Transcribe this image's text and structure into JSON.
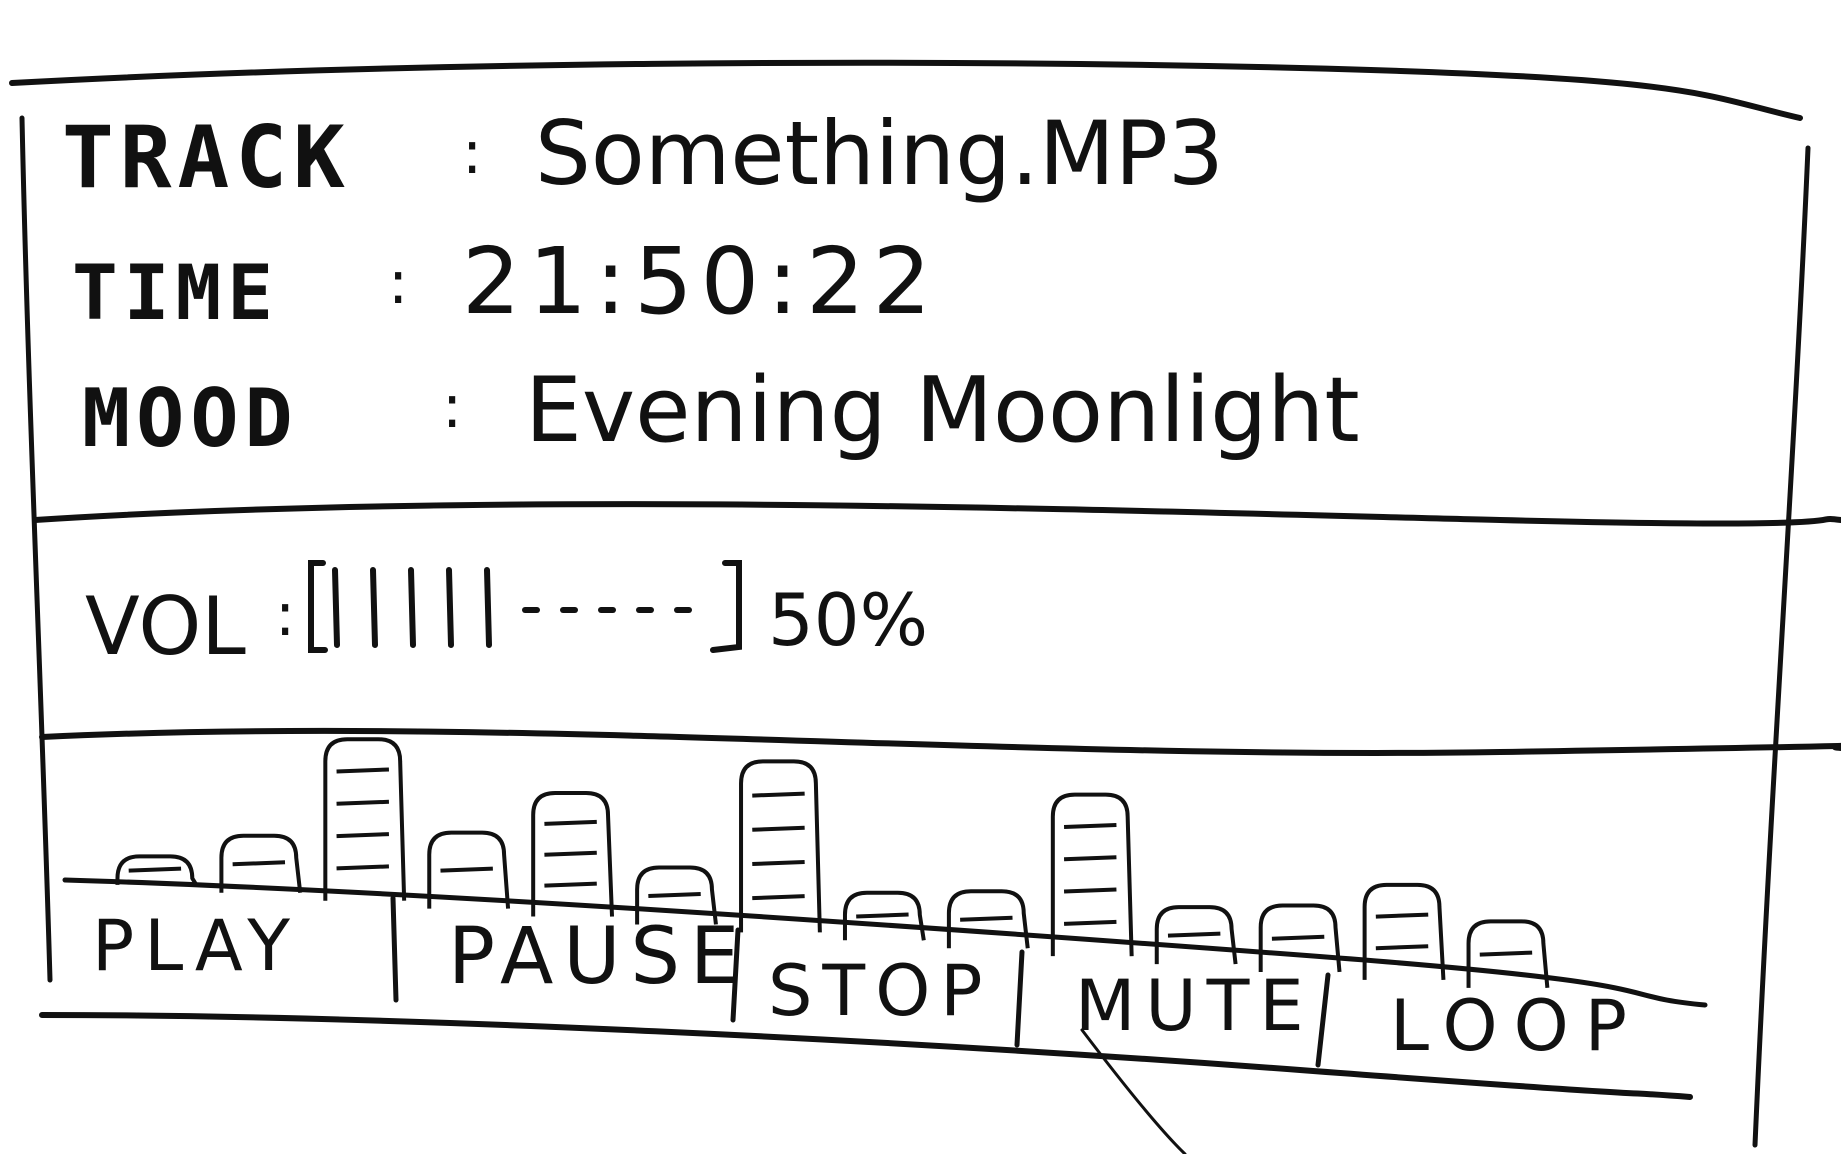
{
  "display": {
    "track": {
      "label": "TRACK",
      "value": "Something.MP3"
    },
    "time": {
      "label": "TIME",
      "value": "21:50:22"
    },
    "mood": {
      "label": "MOOD",
      "value": "Evening Moonlight"
    }
  },
  "volume": {
    "label": "VOL",
    "level_percent": 50,
    "display_text": "50%"
  },
  "equalizer": {
    "bar_levels": [
      0.15,
      0.3,
      0.85,
      0.4,
      0.65,
      0.3,
      0.9,
      0.25,
      0.3,
      0.85,
      0.3,
      0.35,
      0.5,
      0.35
    ]
  },
  "controls": [
    {
      "label": "PLAY"
    },
    {
      "label": "PAUSE"
    },
    {
      "label": "STOP"
    },
    {
      "label": "MUTE"
    },
    {
      "label": "LOOP"
    }
  ],
  "colors": {
    "ink": "#111111",
    "paper": "#ffffff"
  }
}
